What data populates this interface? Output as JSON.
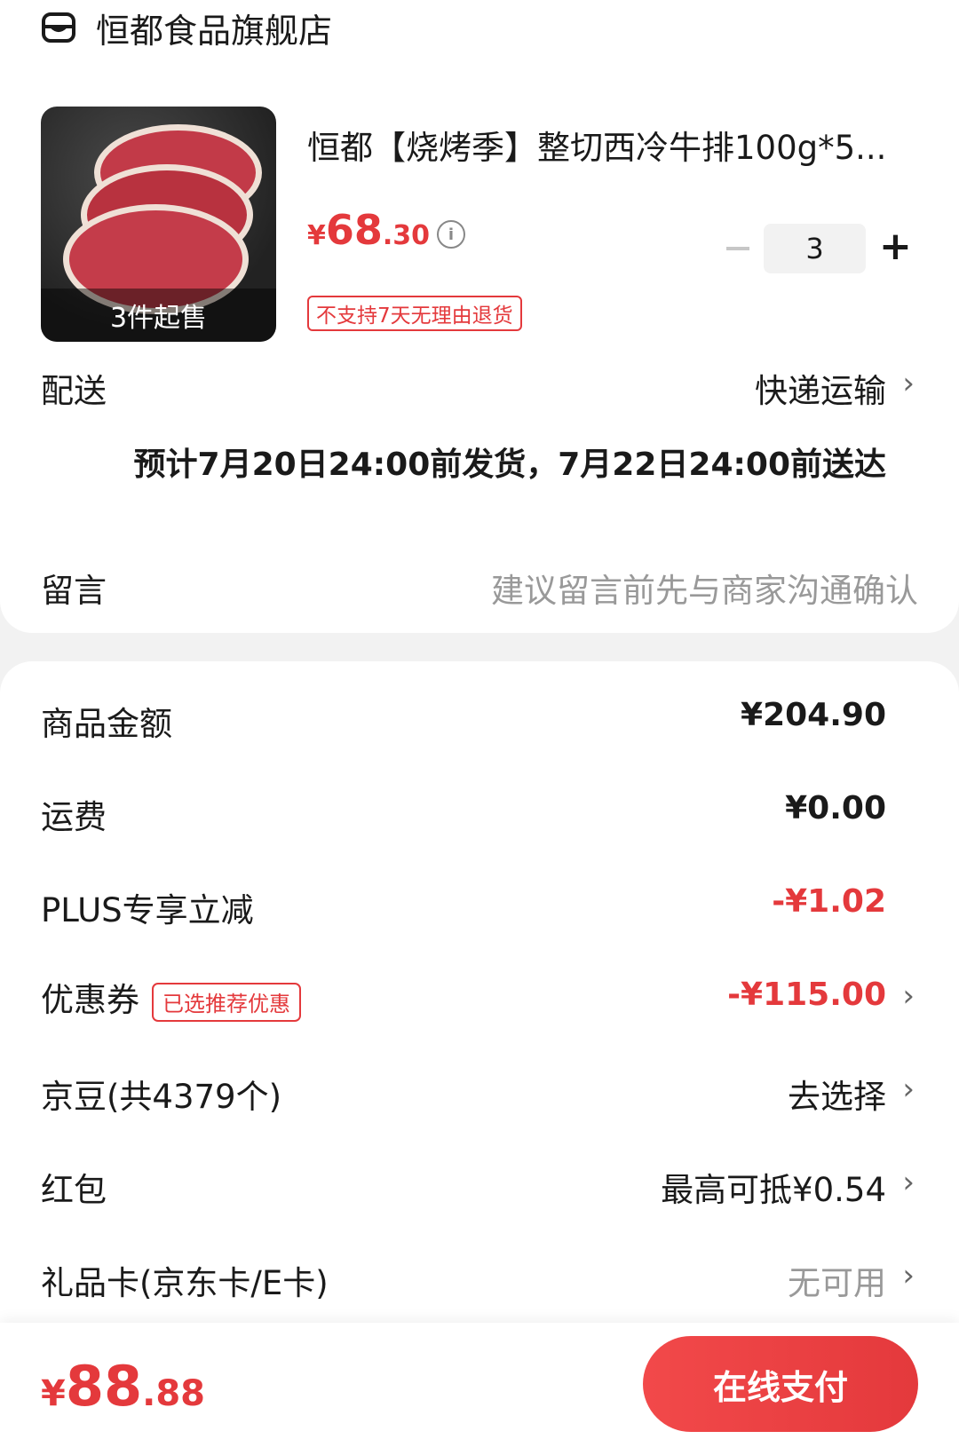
{
  "store": {
    "name": "恒都食品旗舰店",
    "icon": "store-icon"
  },
  "product": {
    "title": "恒都【烧烤季】整切西冷牛排100g*5...",
    "min_purchase_badge": "3件起售",
    "price": {
      "currency": "¥",
      "integer": "68",
      "decimal": ".30"
    },
    "quantity": "3",
    "minus_label": "−",
    "plus_label": "+",
    "return_tag": "不支持7天无理由退货"
  },
  "delivery": {
    "label": "配送",
    "method": "快递运输",
    "detail": "预计7月20日24:00前发货，7月22日24:00前送达"
  },
  "message": {
    "label": "留言",
    "placeholder": "建议留言前先与商家沟通确认"
  },
  "summary": {
    "goods_amount": {
      "label": "商品金额",
      "value": "¥204.90"
    },
    "shipping": {
      "label": "运费",
      "value": "¥0.00"
    },
    "plus_discount": {
      "label": "PLUS专享立减",
      "value": "-¥1.02"
    },
    "coupon": {
      "label": "优惠券",
      "tag": "已选推荐优惠",
      "value": "-¥115.00"
    },
    "jd_beans": {
      "label": "京豆(共4379个)",
      "value": "去选择"
    },
    "red_packet": {
      "label": "红包",
      "value": "最高可抵¥0.54"
    },
    "gift_card": {
      "label": "礼品卡(京东卡/E卡)",
      "value": "无可用"
    }
  },
  "footer": {
    "total": {
      "currency": "¥",
      "integer": "88",
      "decimal": ".88"
    },
    "pay_button": "在线支付"
  },
  "colors": {
    "accent": "#e4393c",
    "muted": "#999999",
    "background": "#f2f2f2"
  }
}
